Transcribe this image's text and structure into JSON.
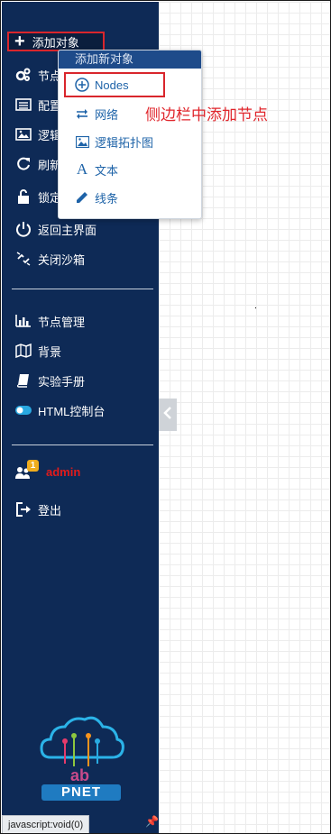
{
  "sidebar": {
    "add_object": "添加对象",
    "items": [
      {
        "label": "节点",
        "icon": "gears-icon"
      },
      {
        "label": "配置",
        "icon": "list-icon"
      },
      {
        "label": "逻辑",
        "icon": "image-icon"
      },
      {
        "label": "刷新",
        "icon": "refresh-icon"
      },
      {
        "label": "锁定",
        "icon": "unlock-icon"
      },
      {
        "label": "返回主界面",
        "icon": "power-icon"
      },
      {
        "label": "关闭沙箱",
        "icon": "unlink-icon"
      }
    ],
    "section2": [
      {
        "label": "节点管理",
        "icon": "bar-chart-icon"
      },
      {
        "label": "背景",
        "icon": "map-icon"
      },
      {
        "label": "实验手册",
        "icon": "book-icon"
      },
      {
        "label": "HTML控制台",
        "icon": "toggle-icon"
      }
    ],
    "user": {
      "name": "admin",
      "badge": "1"
    },
    "logout": "登出",
    "logo_text": "PNET"
  },
  "dropdown": {
    "header": "添加新对象",
    "items": [
      {
        "label": "Nodes",
        "icon": "plus-circle-icon"
      },
      {
        "label": "网络",
        "icon": "exchange-icon"
      },
      {
        "label": "逻辑拓扑图",
        "icon": "picture-icon"
      },
      {
        "label": "文本",
        "icon": "font-icon"
      },
      {
        "label": "线条",
        "icon": "pencil-icon"
      }
    ]
  },
  "annotation": "侧边栏中添加节点",
  "statusbar": "javascript:void(0)",
  "colors": {
    "sidebar": "#0e2a56",
    "highlight": "#d9262c",
    "link": "#1e63a8"
  }
}
